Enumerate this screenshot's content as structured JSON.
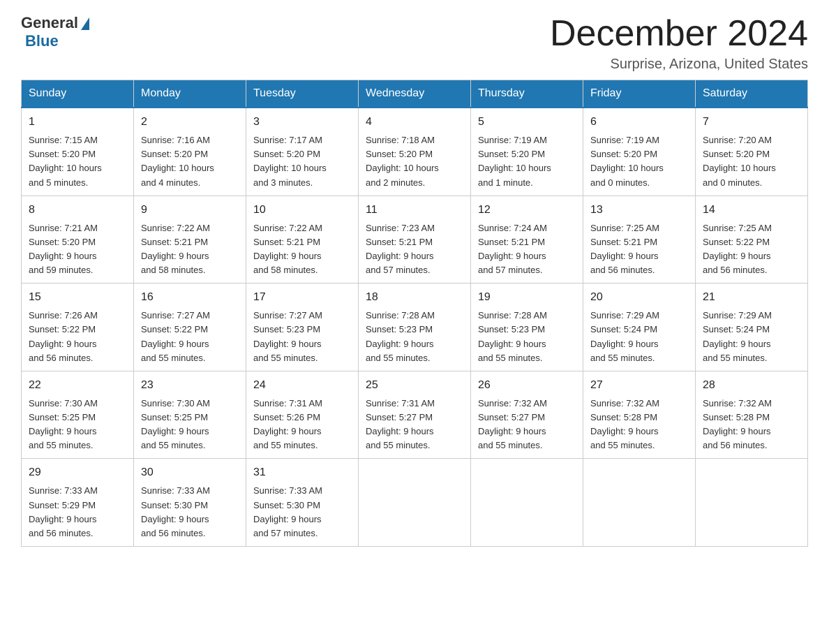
{
  "header": {
    "logo_general": "General",
    "logo_blue": "Blue",
    "month_title": "December 2024",
    "location": "Surprise, Arizona, United States"
  },
  "days_of_week": [
    "Sunday",
    "Monday",
    "Tuesday",
    "Wednesday",
    "Thursday",
    "Friday",
    "Saturday"
  ],
  "weeks": [
    [
      {
        "day": "1",
        "info": "Sunrise: 7:15 AM\nSunset: 5:20 PM\nDaylight: 10 hours\nand 5 minutes."
      },
      {
        "day": "2",
        "info": "Sunrise: 7:16 AM\nSunset: 5:20 PM\nDaylight: 10 hours\nand 4 minutes."
      },
      {
        "day": "3",
        "info": "Sunrise: 7:17 AM\nSunset: 5:20 PM\nDaylight: 10 hours\nand 3 minutes."
      },
      {
        "day": "4",
        "info": "Sunrise: 7:18 AM\nSunset: 5:20 PM\nDaylight: 10 hours\nand 2 minutes."
      },
      {
        "day": "5",
        "info": "Sunrise: 7:19 AM\nSunset: 5:20 PM\nDaylight: 10 hours\nand 1 minute."
      },
      {
        "day": "6",
        "info": "Sunrise: 7:19 AM\nSunset: 5:20 PM\nDaylight: 10 hours\nand 0 minutes."
      },
      {
        "day": "7",
        "info": "Sunrise: 7:20 AM\nSunset: 5:20 PM\nDaylight: 10 hours\nand 0 minutes."
      }
    ],
    [
      {
        "day": "8",
        "info": "Sunrise: 7:21 AM\nSunset: 5:20 PM\nDaylight: 9 hours\nand 59 minutes."
      },
      {
        "day": "9",
        "info": "Sunrise: 7:22 AM\nSunset: 5:21 PM\nDaylight: 9 hours\nand 58 minutes."
      },
      {
        "day": "10",
        "info": "Sunrise: 7:22 AM\nSunset: 5:21 PM\nDaylight: 9 hours\nand 58 minutes."
      },
      {
        "day": "11",
        "info": "Sunrise: 7:23 AM\nSunset: 5:21 PM\nDaylight: 9 hours\nand 57 minutes."
      },
      {
        "day": "12",
        "info": "Sunrise: 7:24 AM\nSunset: 5:21 PM\nDaylight: 9 hours\nand 57 minutes."
      },
      {
        "day": "13",
        "info": "Sunrise: 7:25 AM\nSunset: 5:21 PM\nDaylight: 9 hours\nand 56 minutes."
      },
      {
        "day": "14",
        "info": "Sunrise: 7:25 AM\nSunset: 5:22 PM\nDaylight: 9 hours\nand 56 minutes."
      }
    ],
    [
      {
        "day": "15",
        "info": "Sunrise: 7:26 AM\nSunset: 5:22 PM\nDaylight: 9 hours\nand 56 minutes."
      },
      {
        "day": "16",
        "info": "Sunrise: 7:27 AM\nSunset: 5:22 PM\nDaylight: 9 hours\nand 55 minutes."
      },
      {
        "day": "17",
        "info": "Sunrise: 7:27 AM\nSunset: 5:23 PM\nDaylight: 9 hours\nand 55 minutes."
      },
      {
        "day": "18",
        "info": "Sunrise: 7:28 AM\nSunset: 5:23 PM\nDaylight: 9 hours\nand 55 minutes."
      },
      {
        "day": "19",
        "info": "Sunrise: 7:28 AM\nSunset: 5:23 PM\nDaylight: 9 hours\nand 55 minutes."
      },
      {
        "day": "20",
        "info": "Sunrise: 7:29 AM\nSunset: 5:24 PM\nDaylight: 9 hours\nand 55 minutes."
      },
      {
        "day": "21",
        "info": "Sunrise: 7:29 AM\nSunset: 5:24 PM\nDaylight: 9 hours\nand 55 minutes."
      }
    ],
    [
      {
        "day": "22",
        "info": "Sunrise: 7:30 AM\nSunset: 5:25 PM\nDaylight: 9 hours\nand 55 minutes."
      },
      {
        "day": "23",
        "info": "Sunrise: 7:30 AM\nSunset: 5:25 PM\nDaylight: 9 hours\nand 55 minutes."
      },
      {
        "day": "24",
        "info": "Sunrise: 7:31 AM\nSunset: 5:26 PM\nDaylight: 9 hours\nand 55 minutes."
      },
      {
        "day": "25",
        "info": "Sunrise: 7:31 AM\nSunset: 5:27 PM\nDaylight: 9 hours\nand 55 minutes."
      },
      {
        "day": "26",
        "info": "Sunrise: 7:32 AM\nSunset: 5:27 PM\nDaylight: 9 hours\nand 55 minutes."
      },
      {
        "day": "27",
        "info": "Sunrise: 7:32 AM\nSunset: 5:28 PM\nDaylight: 9 hours\nand 55 minutes."
      },
      {
        "day": "28",
        "info": "Sunrise: 7:32 AM\nSunset: 5:28 PM\nDaylight: 9 hours\nand 56 minutes."
      }
    ],
    [
      {
        "day": "29",
        "info": "Sunrise: 7:33 AM\nSunset: 5:29 PM\nDaylight: 9 hours\nand 56 minutes."
      },
      {
        "day": "30",
        "info": "Sunrise: 7:33 AM\nSunset: 5:30 PM\nDaylight: 9 hours\nand 56 minutes."
      },
      {
        "day": "31",
        "info": "Sunrise: 7:33 AM\nSunset: 5:30 PM\nDaylight: 9 hours\nand 57 minutes."
      },
      {
        "day": "",
        "info": ""
      },
      {
        "day": "",
        "info": ""
      },
      {
        "day": "",
        "info": ""
      },
      {
        "day": "",
        "info": ""
      }
    ]
  ]
}
